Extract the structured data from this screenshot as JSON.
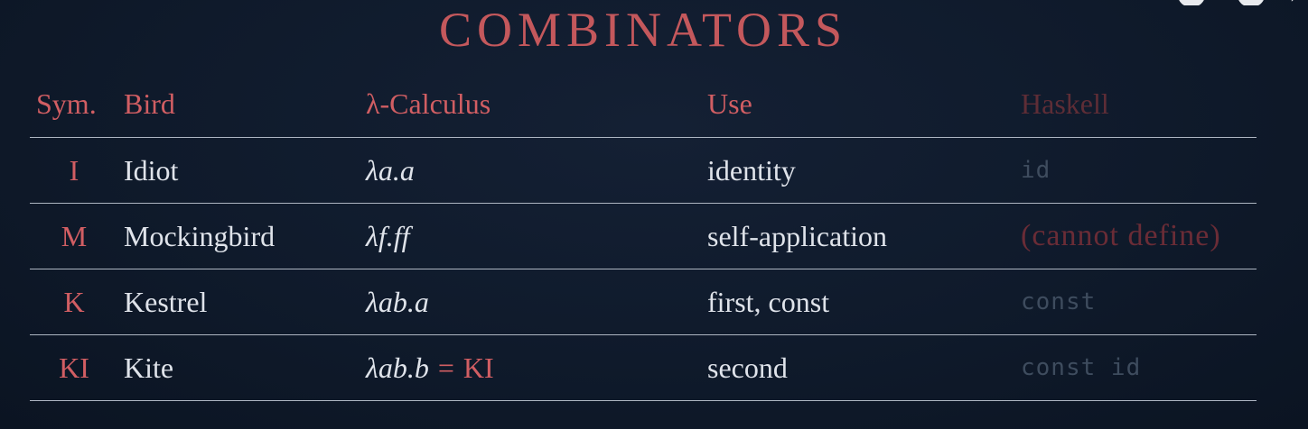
{
  "title": "COMBINATORS",
  "header": {
    "sym": "Sym.",
    "bird": "Bird",
    "lambda": "λ-Calculus",
    "use": "Use",
    "haskell": "Haskell"
  },
  "rows": [
    {
      "sym": "I",
      "bird": "Idiot",
      "lambda": "λa.a",
      "use": "identity",
      "haskell": "id"
    },
    {
      "sym": "M",
      "bird": "Mockingbird",
      "lambda": "λf.ff",
      "use": "self-application",
      "haskell": "(cannot define)"
    },
    {
      "sym": "K",
      "bird": "Kestrel",
      "lambda": "λab.a",
      "use": "first, const",
      "haskell": "const"
    },
    {
      "sym": "KI",
      "bird": "Kite",
      "lambda": "λab.b",
      "lambda_eq": "=",
      "lambda_ki": "KI",
      "use": "second",
      "haskell": "const id"
    }
  ],
  "colors": {
    "accent": "#d15e63",
    "text": "#dfe3ea",
    "background": "#0f1a2b",
    "rule": "#aeb6c2",
    "faded_code": "#3e4c5e"
  }
}
